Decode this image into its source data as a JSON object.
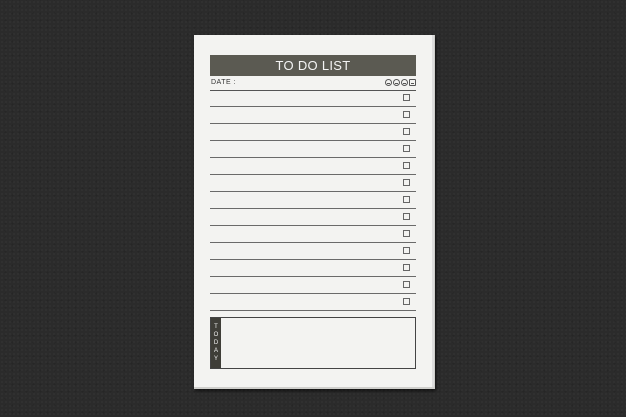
{
  "notepad": {
    "title": "TO DO LIST",
    "date_label": "DATE :",
    "mood_icons": [
      "smiley-face-icon",
      "neutral-face-icon",
      "sad-face-icon",
      "tv-face-icon"
    ],
    "task_lines": 13,
    "today_label": [
      "T",
      "O",
      "D",
      "A",
      "Y"
    ]
  },
  "colors": {
    "background": "#2b2b2b",
    "paper": "#f3f3f1",
    "title_bar": "#5b5a52"
  }
}
